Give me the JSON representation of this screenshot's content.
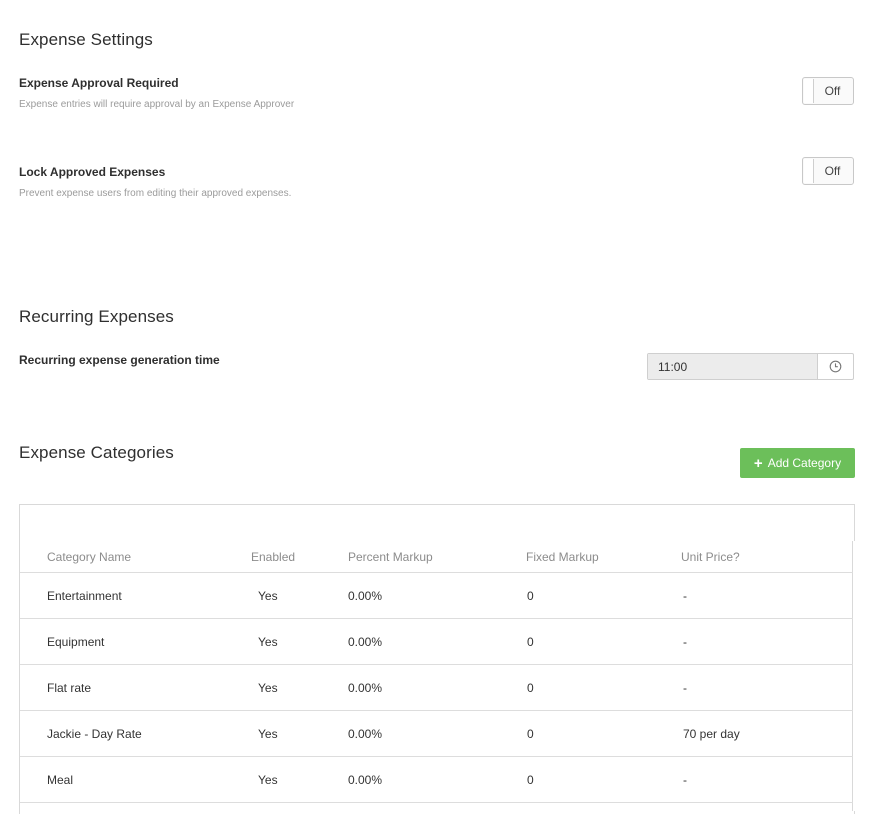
{
  "settings": {
    "title": "Expense Settings",
    "approval": {
      "label": "Expense Approval Required",
      "description": "Expense entries will require approval by an Expense Approver",
      "toggle": "Off"
    },
    "lock": {
      "label": "Lock Approved Expenses",
      "description": "Prevent expense users from editing their approved expenses.",
      "toggle": "Off"
    }
  },
  "recurring": {
    "title": "Recurring Expenses",
    "label": "Recurring expense generation time",
    "time": "11:00",
    "icon": "clock-icon"
  },
  "categories": {
    "title": "Expense Categories",
    "add_button": "Add Category",
    "add_button_color": "#6cbf5a",
    "columns": [
      "Category Name",
      "Enabled",
      "Percent Markup",
      "Fixed Markup",
      "Unit Price?"
    ],
    "rows": [
      [
        "Entertainment",
        "Yes",
        "0.00%",
        "0",
        "-"
      ],
      [
        "Equipment",
        "Yes",
        "0.00%",
        "0",
        "-"
      ],
      [
        "Flat rate",
        "Yes",
        "0.00%",
        "0",
        "-"
      ],
      [
        "Jackie - Day Rate",
        "Yes",
        "0.00%",
        "0",
        "70 per day"
      ],
      [
        "Meal",
        "Yes",
        "0.00%",
        "0",
        "-"
      ]
    ]
  }
}
